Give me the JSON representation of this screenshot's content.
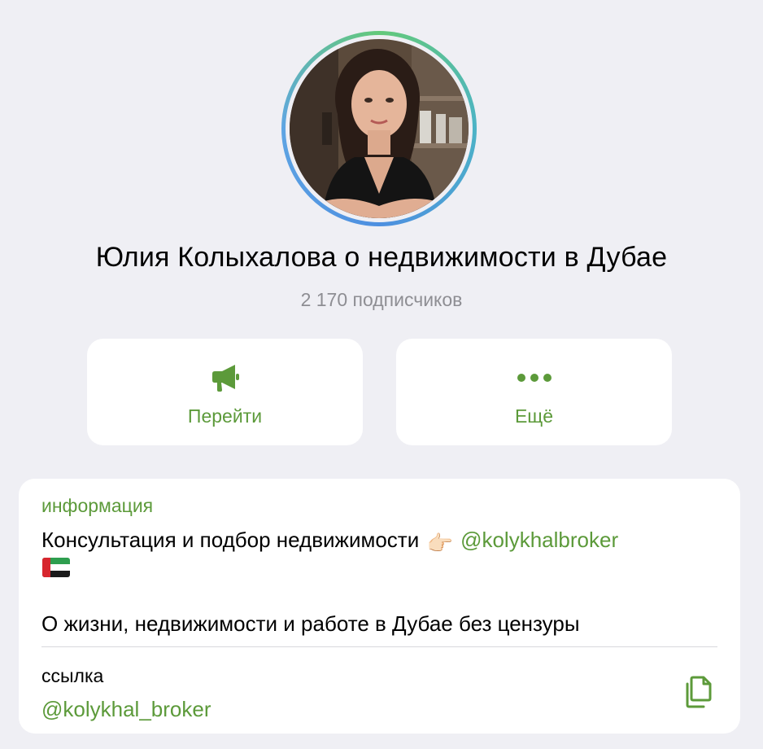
{
  "channel": {
    "title": "Юлия Колыхалова о недвижимости в Дубае",
    "subscribers": "2 170 подписчиков"
  },
  "actions": {
    "go_label": "Перейти",
    "go_icon": "megaphone-icon",
    "more_label": "Ещё",
    "more_icon": "ellipsis-icon"
  },
  "info": {
    "heading": "информация",
    "description_text": "Консультация и подбор недвижимости",
    "description_emoji": "👉🏻",
    "description_mention": "@kolykhalbroker",
    "flag": "🇦🇪",
    "description_line2": "О жизни, недвижимости и работе в Дубае без цензуры",
    "link_label": "ссылка",
    "link_value": "@kolykhal_broker",
    "copy_icon": "copy-icon"
  },
  "colors": {
    "accent": "#5c9a3a",
    "background": "#efeff4",
    "card": "#ffffff",
    "secondary_text": "#8e8e93"
  }
}
